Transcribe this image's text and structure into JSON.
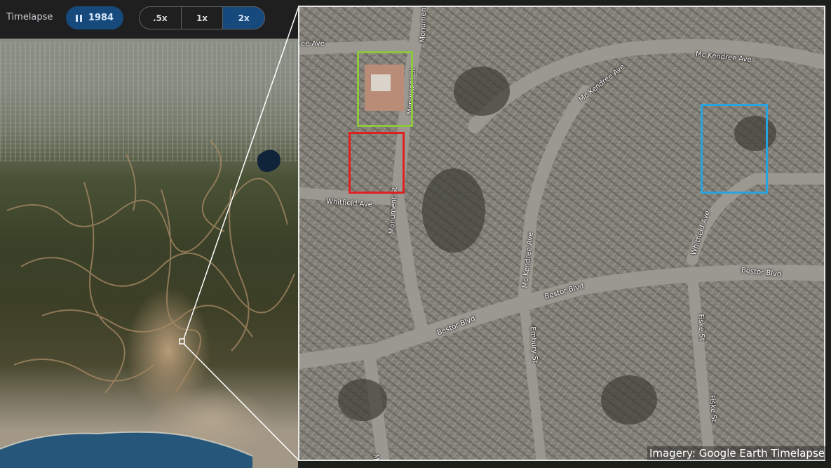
{
  "toolbar": {
    "label": "Timelapse",
    "play_year": "1984",
    "speeds": [
      ".5x",
      "1x",
      "2x"
    ],
    "active_speed": "2x"
  },
  "detail": {
    "street_labels": {
      "mckendree_top": "Mc Kendree Ave",
      "mckendree_diag": "Mc Kendree Ave",
      "mckendree_vert": "Mc Kendree Ave",
      "ee_ave": "ee Ave",
      "monument_top": "Monument St",
      "monument_mid": "Monument St",
      "monument_low": "Monument St",
      "whitfield_left": "Whitfield Ave",
      "whitfield_right": "Whitfield Ave",
      "bestor_right": "Bestor Blvd",
      "bestor_mid": "Bestor Blvd",
      "bestor_left": "Bestor Blvd",
      "fiske_top": "Fiske St",
      "fiske_bottom": "Fiske St",
      "embury": "Embury St",
      "mo_bottom": "Mo"
    },
    "highlight_colors": {
      "green": "#8dc63f",
      "red": "#e02020",
      "blue": "#29a3e0"
    },
    "credit": "Imagery: Google Earth Timelapse"
  }
}
